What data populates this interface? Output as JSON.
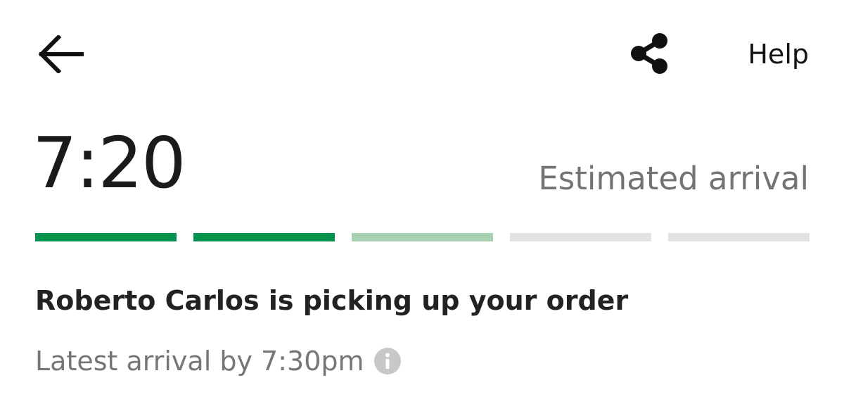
{
  "header": {
    "back_icon": "arrow-left-icon",
    "share_icon": "share-icon",
    "help_label": "Help"
  },
  "eta": {
    "time": "7:20",
    "label": "Estimated arrival"
  },
  "progress": {
    "total_steps": 5,
    "completed_steps": 2,
    "in_progress_steps": 1,
    "colors": {
      "complete": "#05944f",
      "in_progress": "#a8d1b2",
      "pending": "#e2e2e2"
    }
  },
  "status": {
    "message": "Roberto Carlos is picking up your order",
    "latest_arrival": "Latest arrival by 7:30pm",
    "info_icon": "info-icon"
  }
}
